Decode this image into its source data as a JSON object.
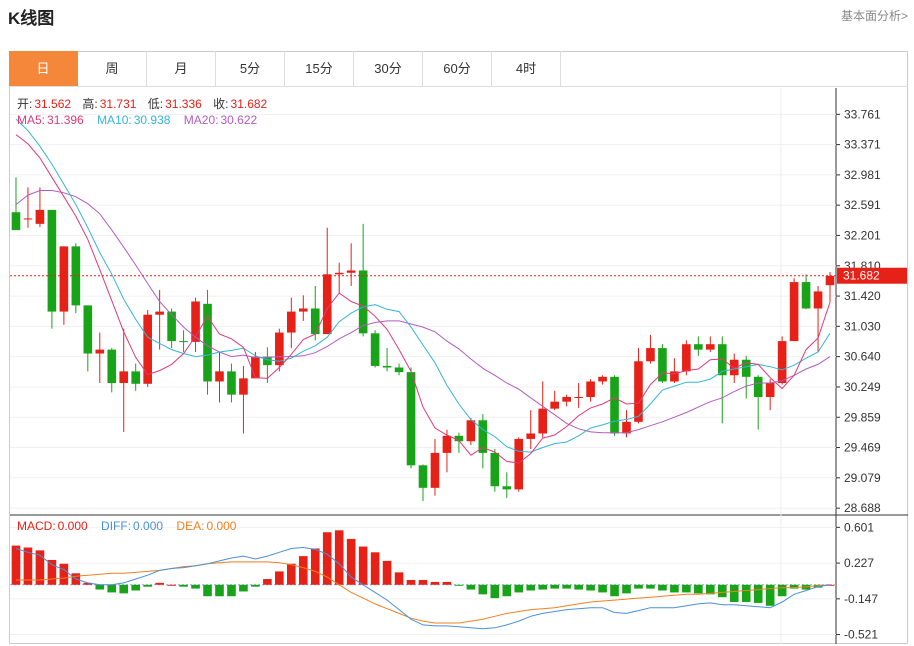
{
  "header": {
    "title": "K线图",
    "more_link": "基本面分析>"
  },
  "tabs": [
    {
      "label": "日"
    },
    {
      "label": "周"
    },
    {
      "label": "月"
    },
    {
      "label": "5分"
    },
    {
      "label": "15分"
    },
    {
      "label": "30分"
    },
    {
      "label": "60分"
    },
    {
      "label": "4时"
    }
  ],
  "ohlc_info": {
    "open_label": "开:",
    "open": "31.562",
    "high_label": "高:",
    "high": "31.731",
    "low_label": "低:",
    "low": "31.336",
    "close_label": "收:",
    "close": "31.682"
  },
  "ma_info": {
    "ma5_label": "MA5:",
    "ma5": "31.396",
    "ma10_label": "MA10:",
    "ma10": "30.938",
    "ma20_label": "MA20:",
    "ma20": "30.622"
  },
  "macd_info": {
    "macd_label": "MACD:",
    "macd": "0.000",
    "diff_label": "DIFF:",
    "diff": "0.000",
    "dea_label": "DEA:",
    "dea": "0.000"
  },
  "colors": {
    "up": "#e62117",
    "down": "#19a319",
    "ma5": "#e0397a",
    "ma10": "#35b5d8",
    "ma20": "#b45bc2",
    "diff": "#4a90d9",
    "dea": "#f08020",
    "accent": "#f5873b"
  },
  "chart_data": {
    "type": "candlestick",
    "last_price": "31.682",
    "price_ticks": [
      "33.761",
      "33.371",
      "32.981",
      "32.591",
      "32.201",
      "31.810",
      "31.420",
      "31.030",
      "30.640",
      "30.249",
      "29.859",
      "29.469",
      "29.079",
      "28.688"
    ],
    "macd_ticks": [
      "0.601",
      "0.227",
      "-0.147",
      "-0.521"
    ],
    "price_range": [
      28.6,
      34.1
    ],
    "macd_range": [
      -0.62,
      0.72
    ],
    "candles": [
      [
        32.5,
        32.27,
        32.95,
        32.27
      ],
      [
        32.42,
        32.42,
        32.82,
        32.3
      ],
      [
        32.35,
        32.53,
        32.82,
        32.31
      ],
      [
        32.53,
        31.22,
        32.53,
        31.0
      ],
      [
        31.22,
        32.06,
        32.06,
        31.05
      ],
      [
        32.06,
        31.3,
        32.1,
        31.2
      ],
      [
        31.3,
        30.68,
        31.3,
        30.45
      ],
      [
        30.68,
        30.73,
        30.95,
        30.3
      ],
      [
        30.73,
        30.3,
        30.75,
        30.18
      ],
      [
        30.3,
        30.45,
        31.0,
        29.67
      ],
      [
        30.45,
        30.29,
        30.55,
        30.2
      ],
      [
        30.29,
        31.18,
        31.24,
        30.25
      ],
      [
        31.18,
        31.22,
        31.5,
        30.73
      ],
      [
        31.22,
        30.84,
        31.26,
        30.75
      ],
      [
        30.84,
        30.83,
        30.98,
        30.7
      ],
      [
        30.83,
        31.35,
        31.4,
        30.7
      ],
      [
        31.32,
        30.32,
        31.5,
        30.15
      ],
      [
        30.32,
        30.45,
        30.7,
        30.05
      ],
      [
        30.45,
        30.15,
        30.55,
        30.05
      ],
      [
        30.15,
        30.36,
        30.52,
        29.65
      ],
      [
        30.36,
        30.64,
        30.7,
        30.36
      ],
      [
        30.64,
        30.53,
        30.76,
        30.3
      ],
      [
        30.53,
        30.95,
        31.0,
        30.45
      ],
      [
        30.95,
        31.22,
        31.4,
        30.75
      ],
      [
        31.22,
        31.26,
        31.43,
        31.1
      ],
      [
        31.26,
        30.93,
        31.55,
        30.85
      ],
      [
        30.93,
        31.7,
        32.3,
        30.95
      ],
      [
        31.7,
        31.72,
        31.85,
        31.45
      ],
      [
        31.72,
        31.75,
        32.1,
        31.55
      ],
      [
        31.75,
        30.94,
        32.35,
        30.9
      ],
      [
        30.94,
        30.52,
        30.98,
        30.5
      ],
      [
        30.52,
        30.5,
        30.75,
        30.45
      ],
      [
        30.5,
        30.44,
        30.55,
        30.4
      ],
      [
        30.44,
        29.24,
        30.5,
        29.2
      ],
      [
        29.24,
        28.95,
        29.25,
        28.78
      ],
      [
        28.95,
        29.4,
        29.58,
        28.85
      ],
      [
        29.4,
        29.62,
        29.7,
        29.15
      ],
      [
        29.62,
        29.55,
        29.66,
        29.4
      ],
      [
        29.55,
        29.82,
        29.85,
        29.5
      ],
      [
        29.82,
        29.4,
        29.9,
        29.2
      ],
      [
        29.4,
        28.97,
        29.45,
        28.9
      ],
      [
        28.97,
        28.93,
        29.15,
        28.82
      ],
      [
        28.93,
        29.58,
        29.6,
        28.9
      ],
      [
        29.58,
        29.65,
        29.95,
        29.45
      ],
      [
        29.65,
        29.97,
        30.32,
        29.6
      ],
      [
        29.97,
        30.06,
        30.2,
        29.95
      ],
      [
        30.06,
        30.12,
        30.15,
        30.0
      ],
      [
        30.12,
        30.12,
        30.3,
        29.98
      ],
      [
        30.12,
        30.32,
        30.35,
        30.06
      ],
      [
        30.32,
        30.38,
        30.4,
        30.28
      ],
      [
        30.38,
        29.65,
        30.4,
        29.62
      ],
      [
        29.65,
        29.8,
        29.95,
        29.6
      ],
      [
        29.8,
        30.58,
        30.75,
        29.78
      ],
      [
        30.58,
        30.75,
        30.92,
        30.55
      ],
      [
        30.75,
        30.32,
        30.8,
        30.3
      ],
      [
        30.32,
        30.45,
        30.62,
        30.3
      ],
      [
        30.45,
        30.8,
        30.85,
        30.4
      ],
      [
        30.8,
        30.73,
        30.9,
        30.65
      ],
      [
        30.73,
        30.8,
        30.9,
        30.7
      ],
      [
        30.8,
        30.4,
        30.9,
        29.78
      ],
      [
        30.4,
        30.6,
        30.68,
        30.3
      ],
      [
        30.6,
        30.38,
        30.65,
        30.1
      ],
      [
        30.38,
        30.12,
        30.4,
        29.7
      ],
      [
        30.12,
        30.3,
        30.35,
        29.95
      ],
      [
        30.3,
        30.84,
        30.9,
        30.28
      ],
      [
        30.84,
        31.6,
        31.65,
        30.86
      ],
      [
        31.6,
        31.26,
        31.7,
        31.25
      ],
      [
        31.26,
        31.48,
        31.55,
        30.7
      ],
      [
        31.56,
        31.68,
        31.73,
        31.34
      ]
    ],
    "ma5": [
      33.5,
      33.38,
      33.2,
      32.95,
      32.7,
      32.45,
      32.15,
      31.76,
      31.36,
      30.96,
      30.63,
      30.41,
      30.46,
      30.54,
      30.68,
      30.9,
      31.16,
      30.93,
      30.87,
      30.76,
      30.37,
      30.36,
      30.5,
      30.67,
      30.86,
      30.93,
      31.26,
      31.46,
      31.35,
      31.29,
      31.16,
      30.99,
      30.73,
      30.45,
      29.99,
      29.72,
      29.63,
      29.56,
      29.37,
      29.47,
      29.41,
      29.29,
      29.27,
      29.39,
      29.59,
      29.63,
      29.74,
      29.88,
      29.98,
      30.03,
      30.11,
      30.03,
      30.04,
      30.28,
      30.43,
      30.42,
      30.46,
      30.48,
      30.6,
      30.61,
      30.49,
      30.56,
      30.54,
      30.37,
      30.23,
      30.4,
      30.73,
      30.88,
      31.34
    ],
    "ma10": [
      33.7,
      33.55,
      33.35,
      33.12,
      32.86,
      32.6,
      32.3,
      31.98,
      31.7,
      31.38,
      31.12,
      30.89,
      30.81,
      30.73,
      30.68,
      30.64,
      30.66,
      30.7,
      30.72,
      30.75,
      30.65,
      30.6,
      30.58,
      30.62,
      30.71,
      30.78,
      30.89,
      31.09,
      31.2,
      31.28,
      31.31,
      31.25,
      31.22,
      31.02,
      30.79,
      30.56,
      30.27,
      30.03,
      29.83,
      29.7,
      29.61,
      29.48,
      29.42,
      29.41,
      29.47,
      29.52,
      29.54,
      29.62,
      29.72,
      29.76,
      29.81,
      29.83,
      29.87,
      30.03,
      30.21,
      30.26,
      30.31,
      30.31,
      30.35,
      30.45,
      30.48,
      30.51,
      30.54,
      30.51,
      30.47,
      30.53,
      30.62,
      30.7,
      30.94
    ],
    "ma20": [
      32.6,
      32.72,
      32.78,
      32.78,
      32.75,
      32.7,
      32.61,
      32.48,
      32.27,
      32.05,
      31.82,
      31.58,
      31.35,
      31.18,
      31.02,
      30.89,
      30.78,
      30.7,
      30.64,
      30.66,
      30.63,
      30.63,
      30.64,
      30.64,
      30.65,
      30.69,
      30.77,
      30.87,
      30.95,
      31.04,
      31.08,
      31.1,
      31.1,
      31.06,
      31.02,
      30.96,
      30.84,
      30.74,
      30.61,
      30.49,
      30.4,
      30.3,
      30.22,
      30.11,
      30.0,
      29.89,
      29.78,
      29.71,
      29.67,
      29.66,
      29.66,
      29.66,
      29.7,
      29.75,
      29.8,
      29.86,
      29.92,
      29.99,
      30.06,
      30.11,
      30.19,
      30.26,
      30.3,
      30.3,
      30.33,
      30.4,
      30.48,
      30.54,
      30.64
    ],
    "macd": [
      0.41,
      0.39,
      0.36,
      0.26,
      0.22,
      0.12,
      0.02,
      -0.05,
      -0.08,
      -0.09,
      -0.06,
      -0.02,
      0.02,
      0.0,
      -0.02,
      -0.04,
      -0.12,
      -0.12,
      -0.12,
      -0.07,
      -0.02,
      0.06,
      0.14,
      0.22,
      0.3,
      0.38,
      0.55,
      0.57,
      0.48,
      0.4,
      0.34,
      0.25,
      0.13,
      0.05,
      0.05,
      0.03,
      0.03,
      -0.01,
      -0.05,
      -0.1,
      -0.14,
      -0.12,
      -0.08,
      -0.06,
      -0.05,
      -0.04,
      -0.04,
      -0.05,
      -0.06,
      -0.08,
      -0.12,
      -0.09,
      -0.04,
      -0.04,
      -0.06,
      -0.08,
      -0.08,
      -0.09,
      -0.1,
      -0.13,
      -0.18,
      -0.18,
      -0.19,
      -0.22,
      -0.12,
      -0.04,
      -0.05,
      -0.03,
      0.0
    ],
    "diff": [
      0.38,
      0.34,
      0.31,
      0.21,
      0.16,
      0.06,
      0.02,
      0.0,
      0.0,
      0.02,
      0.06,
      0.1,
      0.15,
      0.17,
      0.18,
      0.2,
      0.22,
      0.25,
      0.28,
      0.3,
      0.27,
      0.3,
      0.34,
      0.38,
      0.39,
      0.37,
      0.32,
      0.22,
      0.08,
      0.0,
      -0.08,
      -0.16,
      -0.26,
      -0.36,
      -0.42,
      -0.43,
      -0.43,
      -0.44,
      -0.45,
      -0.46,
      -0.45,
      -0.42,
      -0.38,
      -0.33,
      -0.3,
      -0.28,
      -0.26,
      -0.25,
      -0.24,
      -0.24,
      -0.29,
      -0.3,
      -0.27,
      -0.24,
      -0.24,
      -0.24,
      -0.22,
      -0.2,
      -0.19,
      -0.21,
      -0.21,
      -0.22,
      -0.23,
      -0.24,
      -0.18,
      -0.1,
      -0.06,
      -0.02,
      0.0
    ],
    "dea": [
      0.05,
      0.05,
      0.05,
      0.06,
      0.07,
      0.09,
      0.1,
      0.11,
      0.12,
      0.12,
      0.13,
      0.14,
      0.15,
      0.17,
      0.19,
      0.2,
      0.22,
      0.23,
      0.24,
      0.24,
      0.24,
      0.24,
      0.23,
      0.21,
      0.18,
      0.14,
      0.08,
      0.0,
      -0.08,
      -0.14,
      -0.2,
      -0.25,
      -0.3,
      -0.35,
      -0.38,
      -0.4,
      -0.4,
      -0.4,
      -0.38,
      -0.36,
      -0.33,
      -0.3,
      -0.28,
      -0.26,
      -0.25,
      -0.24,
      -0.22,
      -0.2,
      -0.18,
      -0.17,
      -0.16,
      -0.15,
      -0.14,
      -0.13,
      -0.12,
      -0.11,
      -0.1,
      -0.1,
      -0.09,
      -0.08,
      -0.07,
      -0.06,
      -0.05,
      -0.04,
      -0.03,
      -0.03,
      -0.02,
      -0.01,
      0.0
    ]
  }
}
